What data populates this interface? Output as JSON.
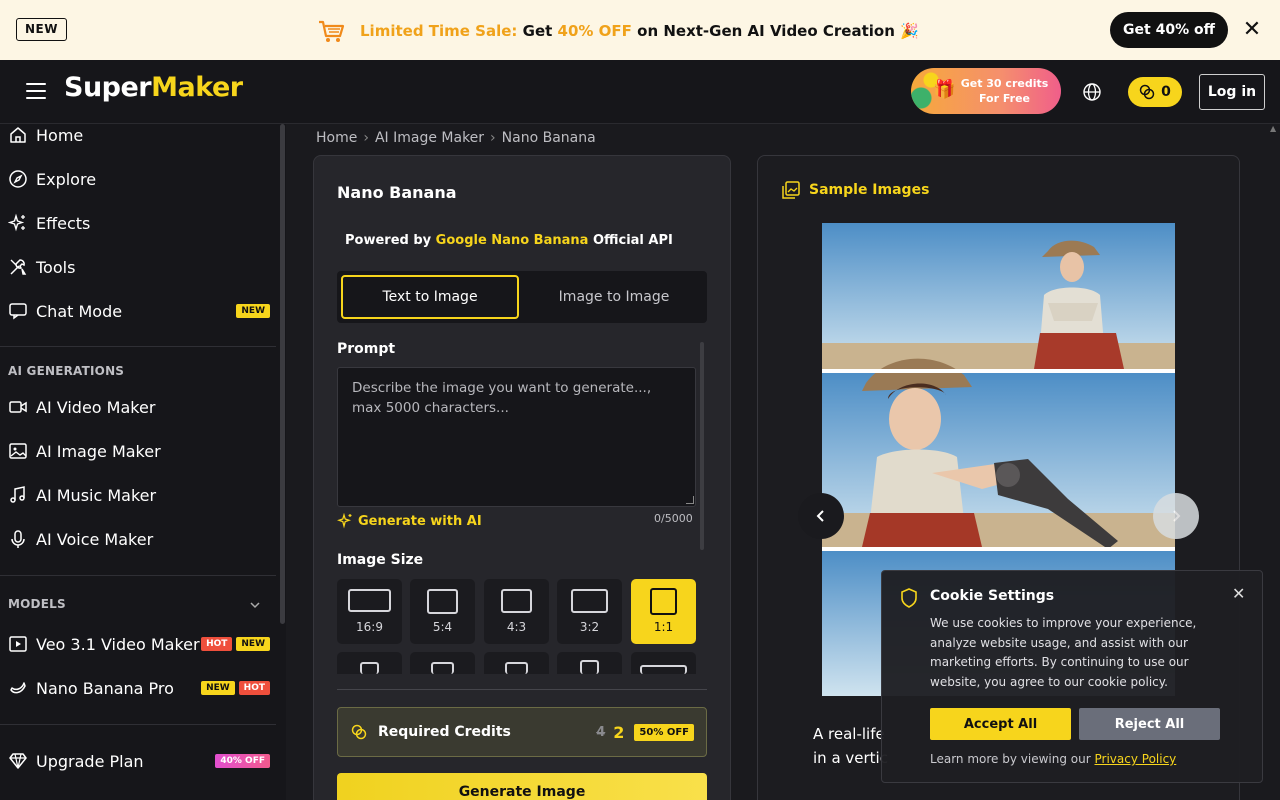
{
  "promo": {
    "badge": "NEW",
    "sale_prefix": "Limited Time Sale:",
    "sale_get": "Get",
    "sale_pct": "40% OFF",
    "sale_rest": "on Next-Gen AI Video Creation",
    "sale_emoji": "🎉",
    "cta": "Get 40% off",
    "close": "✕"
  },
  "header": {
    "logo_a": "Super",
    "logo_b": "Maker",
    "credits_promo": "Get 30 credits For Free",
    "coins": "0",
    "login": "Log in"
  },
  "sidebar": {
    "main": [
      {
        "label": "Home",
        "icon": "home-icon"
      },
      {
        "label": "Explore",
        "icon": "compass-icon"
      },
      {
        "label": "Effects",
        "icon": "sparkles-icon"
      },
      {
        "label": "Tools",
        "icon": "tools-icon"
      },
      {
        "label": "Chat Mode",
        "icon": "chat-icon",
        "tag": "NEW"
      }
    ],
    "gen_title": "AI GENERATIONS",
    "generations": [
      {
        "label": "AI Video Maker",
        "icon": "video-icon"
      },
      {
        "label": "AI Image Maker",
        "icon": "image-icon"
      },
      {
        "label": "AI Music Maker",
        "icon": "music-icon"
      },
      {
        "label": "AI Voice Maker",
        "icon": "mic-icon"
      }
    ],
    "models_title": "MODELS",
    "models": [
      {
        "label": "Veo 3.1 Video Maker",
        "tags": [
          "HOT",
          "NEW"
        ]
      },
      {
        "label": "Nano Banana Pro",
        "tags": [
          "NEW",
          "HOT"
        ]
      }
    ],
    "upgrade": {
      "label": "Upgrade Plan",
      "tag": "40% OFF"
    }
  },
  "breadcrumb": [
    "Home",
    "AI Image Maker",
    "Nano Banana"
  ],
  "form": {
    "title": "Nano Banana",
    "powered_prefix": "Powered by",
    "powered_brand": "Google Nano Banana",
    "powered_suffix": "Official API",
    "tab_text": "Text to Image",
    "tab_image": "Image to Image",
    "prompt_label": "Prompt",
    "prompt_placeholder": "Describe the image you want to generate..., max 5000 characters...",
    "prompt_value": "",
    "gen_ai": "Generate with AI",
    "counter": "0/5000",
    "size_label": "Image Size",
    "sizes": [
      "16:9",
      "5:4",
      "4:3",
      "3:2",
      "1:1"
    ],
    "selected_size": "1:1",
    "credits_label": "Required Credits",
    "credits_old": "4",
    "credits_new": "2",
    "credits_discount": "50% OFF",
    "generate": "Generate Image"
  },
  "sample": {
    "title": "Sample Images",
    "caption_line1": "A real-life",
    "caption_line2": "in a vertic"
  },
  "cookie": {
    "title": "Cookie Settings",
    "body": "We use cookies to improve your experience, analyze website usage, and assist with our marketing efforts. By continuing to use our website, you agree to our cookie policy.",
    "accept": "Accept All",
    "reject": "Reject All",
    "foot_prefix": "Learn more by viewing our",
    "foot_link": "Privacy Policy",
    "close": "✕"
  },
  "colors": {
    "accent": "#f7d51c",
    "hot": "#ef4f3c",
    "bg": "#1a1a1e"
  }
}
